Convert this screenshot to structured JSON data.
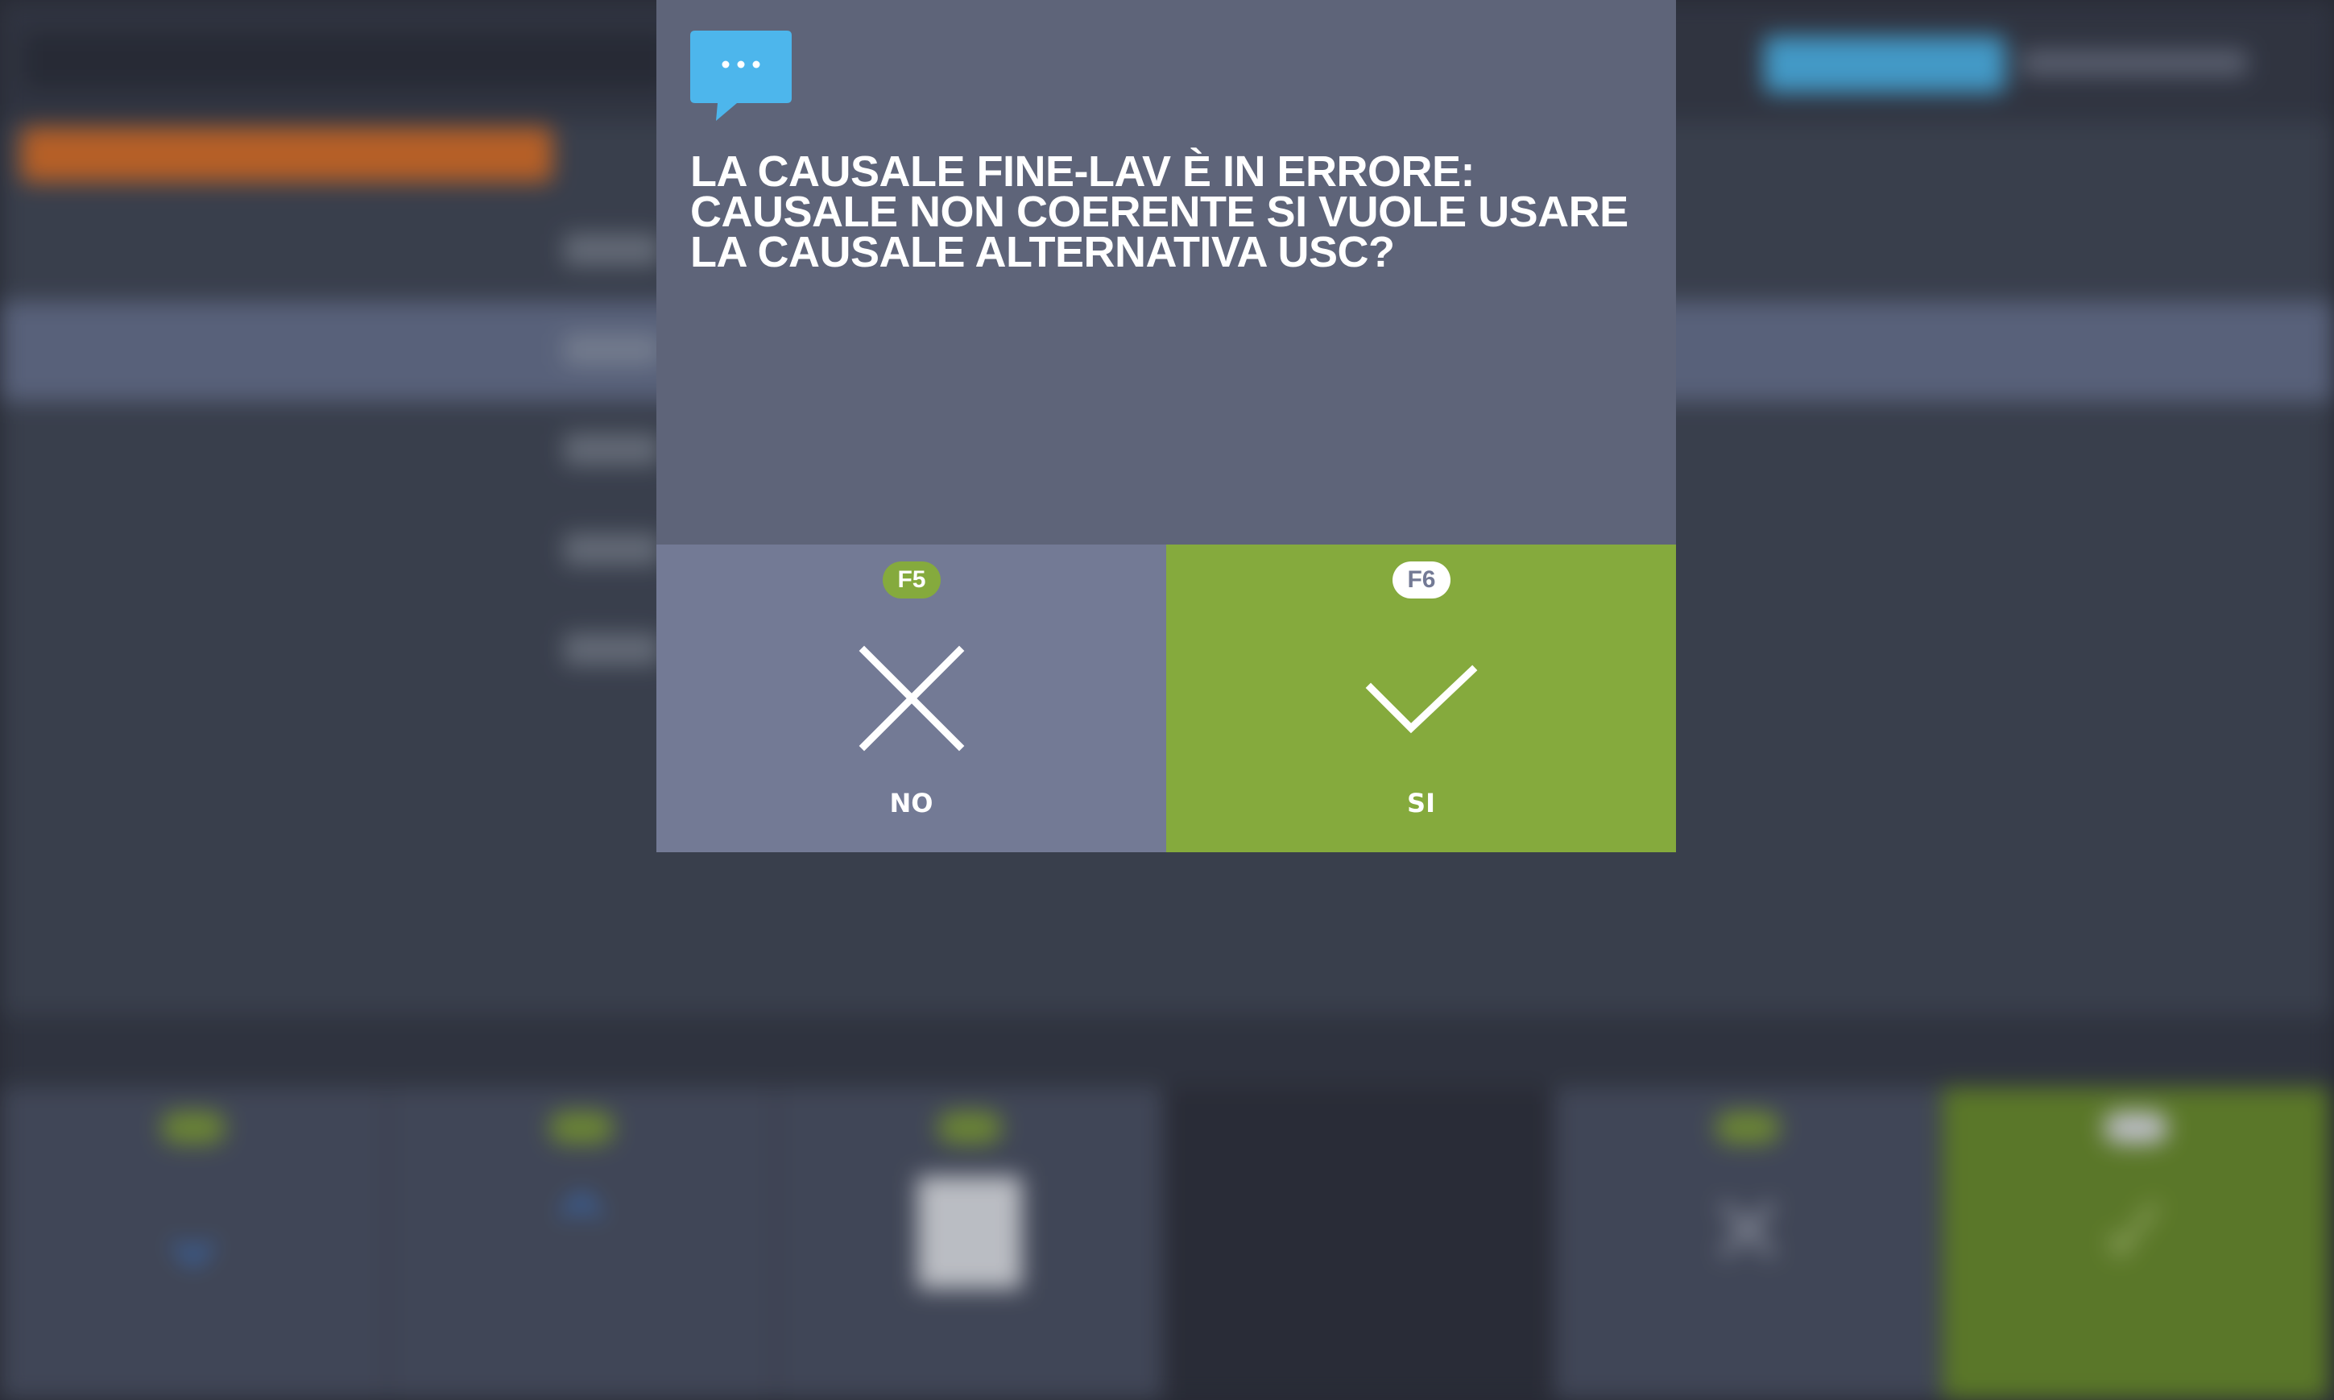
{
  "dialog": {
    "message": "LA CAUSALE FINE-LAV È IN ERRORE: CAUSALE NON COERENTE SI VUOLE USARE LA CAUSALE ALTERNATIVA USC?",
    "icon": "speech-bubble-icon",
    "buttons": {
      "no": {
        "key": "F5",
        "label": "NO",
        "icon": "close-icon"
      },
      "yes": {
        "key": "F6",
        "label": "SI",
        "icon": "check-icon"
      }
    }
  },
  "colors": {
    "dialog_bg": "#5e6479",
    "no_button": "#737a95",
    "yes_button": "#85aa3d",
    "icon_blue": "#4db6ec",
    "accent_orange": "#d9702a"
  }
}
